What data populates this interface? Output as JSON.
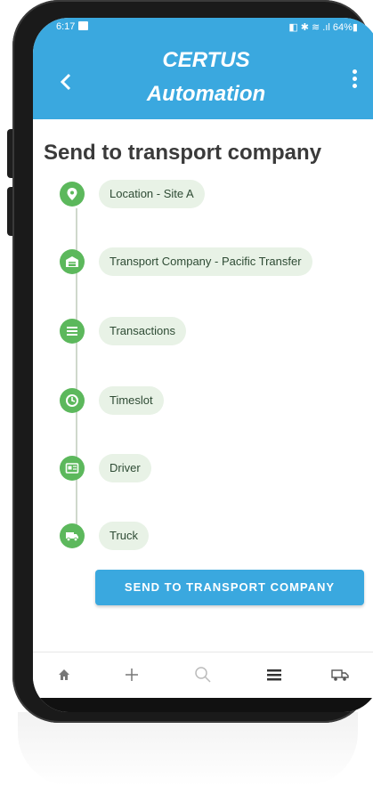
{
  "status_bar": {
    "time": "6:17",
    "right_text": "◧ ✱ ≋ .ıl 64%▮"
  },
  "app_bar": {
    "title_line1": "CERTUS",
    "title_line2": "Automation",
    "back_icon": "chevron-left-icon",
    "menu_icon": "more-vert-icon"
  },
  "page": {
    "title": "Send to transport company"
  },
  "steps": [
    {
      "label": "Location - Site A",
      "icon": "location-pin-icon"
    },
    {
      "label": "Transport Company - Pacific Transfer",
      "icon": "warehouse-icon"
    },
    {
      "label": "Transactions",
      "icon": "list-icon"
    },
    {
      "label": "Timeslot",
      "icon": "clock-icon"
    },
    {
      "label": "Driver",
      "icon": "id-card-icon"
    },
    {
      "label": "Truck",
      "icon": "truck-icon"
    }
  ],
  "actions": {
    "send_label": "SEND TO TRANSPORT COMPANY"
  },
  "bottom_nav": [
    "home-icon",
    "add-icon",
    "search-icon",
    "list-icon",
    "truck-icon"
  ],
  "system_nav": {
    "recents": "|||",
    "home": "○",
    "back": "‹"
  },
  "colors": {
    "primary": "#3aa8df",
    "step_green": "#5cb85c",
    "pill_bg": "#e8f2e6"
  }
}
